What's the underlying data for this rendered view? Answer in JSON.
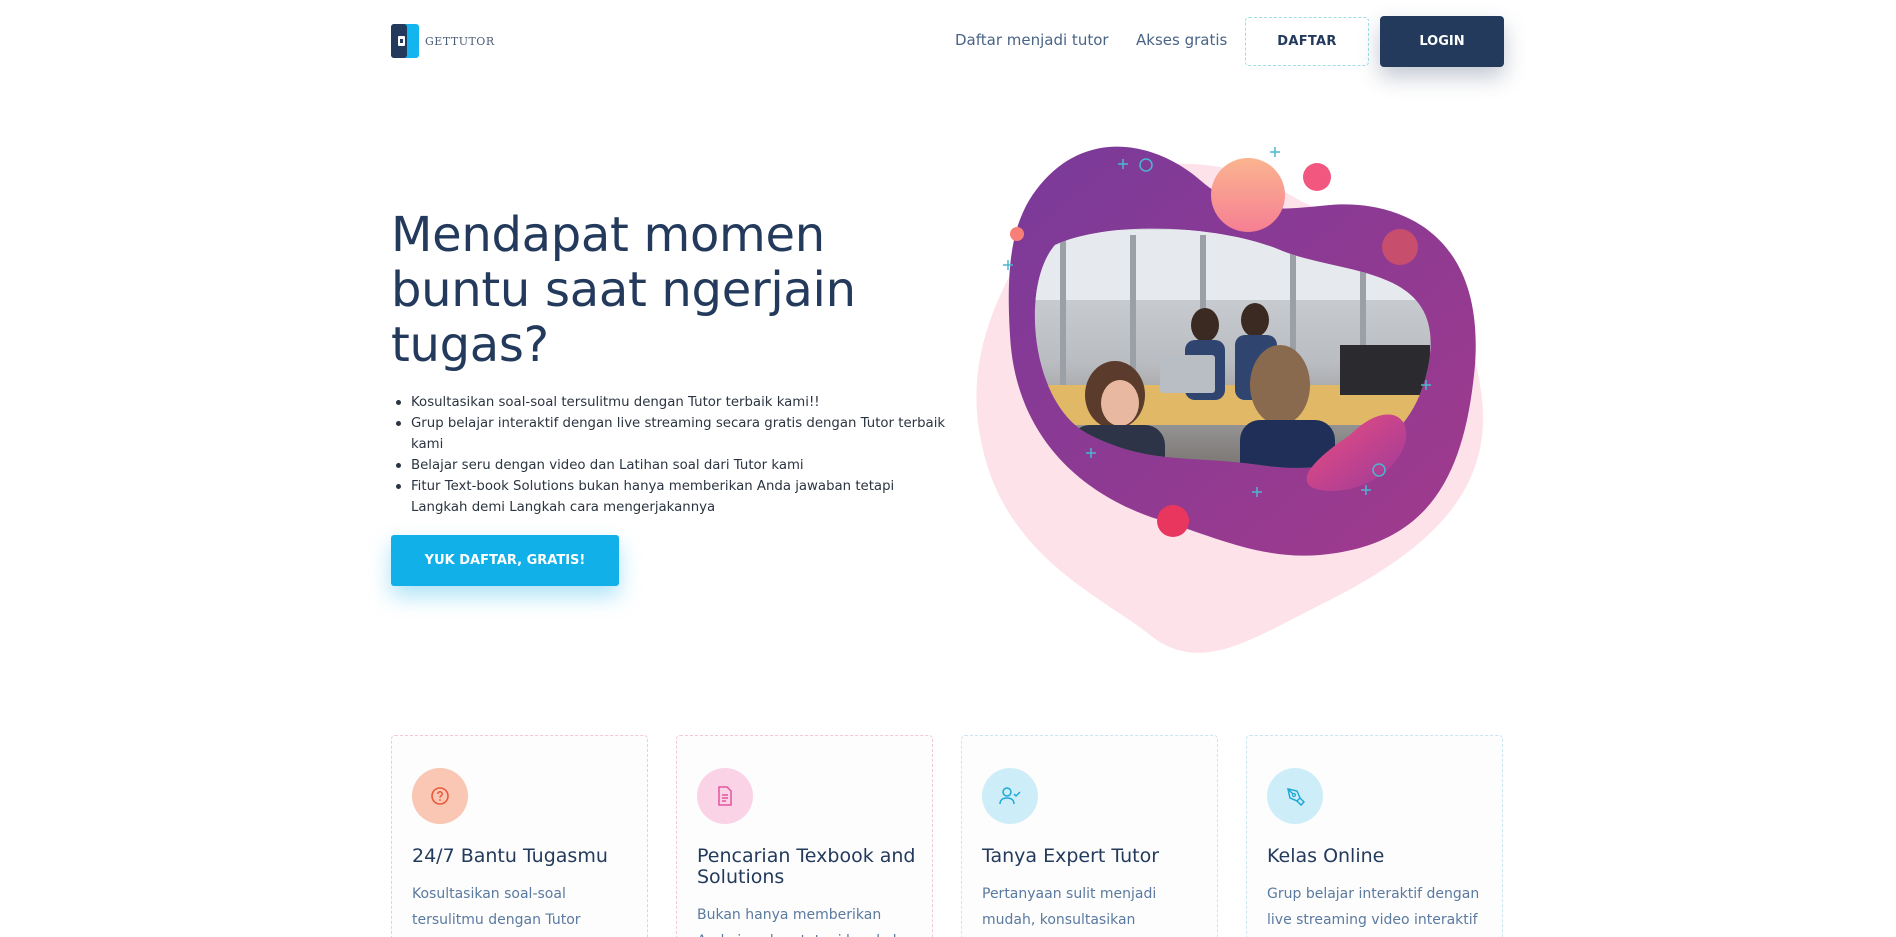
{
  "brand": {
    "name": "GETTUTOR"
  },
  "nav": {
    "link_tutor": "Daftar menjadi tutor",
    "link_free": "Akses gratis",
    "daftar_label": "DAFTAR",
    "login_label": "LOGIN"
  },
  "hero": {
    "title": "Mendapat momen buntu saat ngerjain tugas?",
    "bullets": [
      "Kosultasikan soal-soal tersulitmu dengan Tutor terbaik kami!!",
      "Grup belajar interaktif dengan live streaming secara gratis dengan Tutor terbaik kami",
      "Belajar seru dengan video dan Latihan soal dari Tutor kami",
      "Fitur Text-book Solutions bukan hanya memberikan Anda jawaban tetapi Langkah demi Langkah cara mengerjakannya"
    ],
    "cta_label": "YUK DAFTAR, GRATIS!"
  },
  "features": [
    {
      "icon": "question-circle-icon",
      "title": "24/7 Bantu Tugasmu",
      "desc": "Kosultasikan soal-soal tersulitmu dengan Tutor",
      "color": "#f4b9a1"
    },
    {
      "icon": "document-icon",
      "title": "Pencarian Texbook and Solutions",
      "desc": "Bukan hanya memberikan Anda jawaban tetapi langkah",
      "color": "#f9c9df"
    },
    {
      "icon": "user-check-icon",
      "title": "Tanya Expert Tutor",
      "desc": "Pertanyaan sulit menjadi mudah, konsultasikan",
      "color": "#c6ebf8"
    },
    {
      "icon": "pen-tool-icon",
      "title": "Kelas Online",
      "desc": "Grup belajar interaktif dengan live streaming video interaktif",
      "color": "#c6ebf8"
    }
  ],
  "colors": {
    "primary": "#233a5c",
    "accent": "#11b0e9",
    "blob_purple": "#8c3a9c",
    "blob_pink": "#fde0e8"
  }
}
